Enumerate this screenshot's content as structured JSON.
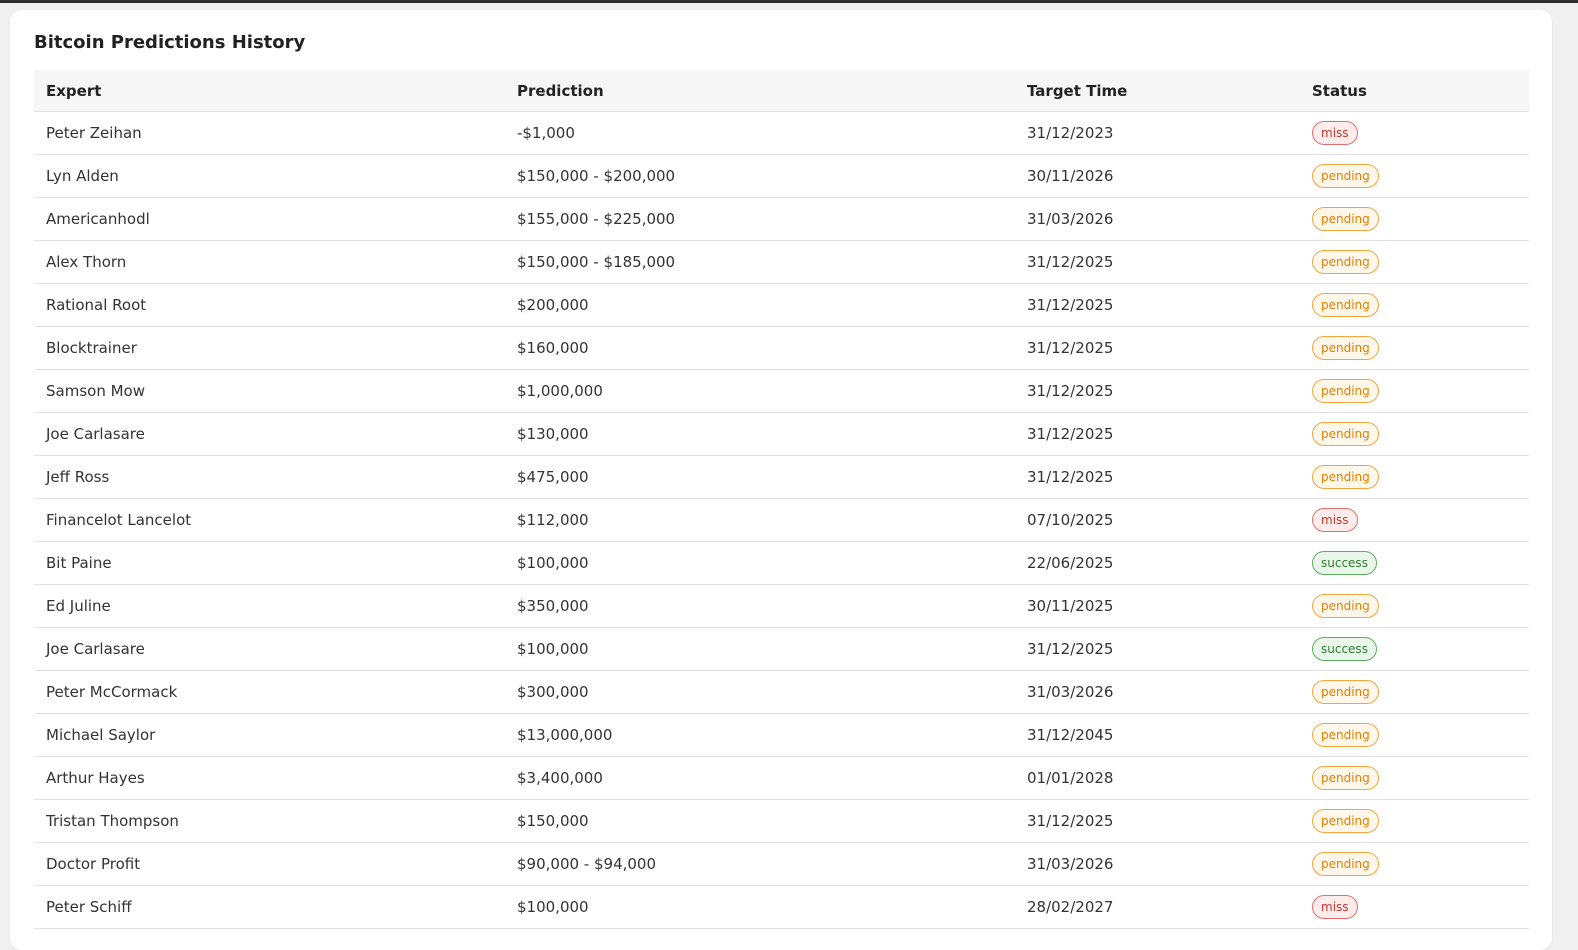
{
  "card": {
    "title": "Bitcoin Predictions History"
  },
  "table": {
    "headers": {
      "expert": "Expert",
      "prediction": "Prediction",
      "target_time": "Target Time",
      "status": "Status"
    },
    "rows": [
      {
        "expert": "Peter Zeihan",
        "prediction": "-$1,000",
        "target_time": "31/12/2023",
        "status": "miss"
      },
      {
        "expert": "Lyn Alden",
        "prediction": "$150,000 - $200,000",
        "target_time": "30/11/2026",
        "status": "pending"
      },
      {
        "expert": "Americanhodl",
        "prediction": "$155,000 - $225,000",
        "target_time": "31/03/2026",
        "status": "pending"
      },
      {
        "expert": "Alex Thorn",
        "prediction": "$150,000 - $185,000",
        "target_time": "31/12/2025",
        "status": "pending"
      },
      {
        "expert": "Rational Root",
        "prediction": "$200,000",
        "target_time": "31/12/2025",
        "status": "pending"
      },
      {
        "expert": "Blocktrainer",
        "prediction": "$160,000",
        "target_time": "31/12/2025",
        "status": "pending"
      },
      {
        "expert": "Samson Mow",
        "prediction": "$1,000,000",
        "target_time": "31/12/2025",
        "status": "pending"
      },
      {
        "expert": "Joe Carlasare",
        "prediction": "$130,000",
        "target_time": "31/12/2025",
        "status": "pending"
      },
      {
        "expert": "Jeff Ross",
        "prediction": "$475,000",
        "target_time": "31/12/2025",
        "status": "pending"
      },
      {
        "expert": "Financelot Lancelot",
        "prediction": "$112,000",
        "target_time": "07/10/2025",
        "status": "miss"
      },
      {
        "expert": "Bit Paine",
        "prediction": "$100,000",
        "target_time": "22/06/2025",
        "status": "success"
      },
      {
        "expert": "Ed Juline",
        "prediction": "$350,000",
        "target_time": "30/11/2025",
        "status": "pending"
      },
      {
        "expert": "Joe Carlasare",
        "prediction": "$100,000",
        "target_time": "31/12/2025",
        "status": "success"
      },
      {
        "expert": "Peter McCormack",
        "prediction": "$300,000",
        "target_time": "31/03/2026",
        "status": "pending"
      },
      {
        "expert": "Michael Saylor",
        "prediction": "$13,000,000",
        "target_time": "31/12/2045",
        "status": "pending"
      },
      {
        "expert": "Arthur Hayes",
        "prediction": "$3,400,000",
        "target_time": "01/01/2028",
        "status": "pending"
      },
      {
        "expert": "Tristan Thompson",
        "prediction": "$150,000",
        "target_time": "31/12/2025",
        "status": "pending"
      },
      {
        "expert": "Doctor Profit",
        "prediction": "$90,000 - $94,000",
        "target_time": "31/03/2026",
        "status": "pending"
      },
      {
        "expert": "Peter Schiff",
        "prediction": "$100,000",
        "target_time": "28/02/2027",
        "status": "miss"
      }
    ]
  },
  "status_colors": {
    "miss": "#c0392b",
    "pending": "#e67e00",
    "success": "#2e7d32"
  }
}
